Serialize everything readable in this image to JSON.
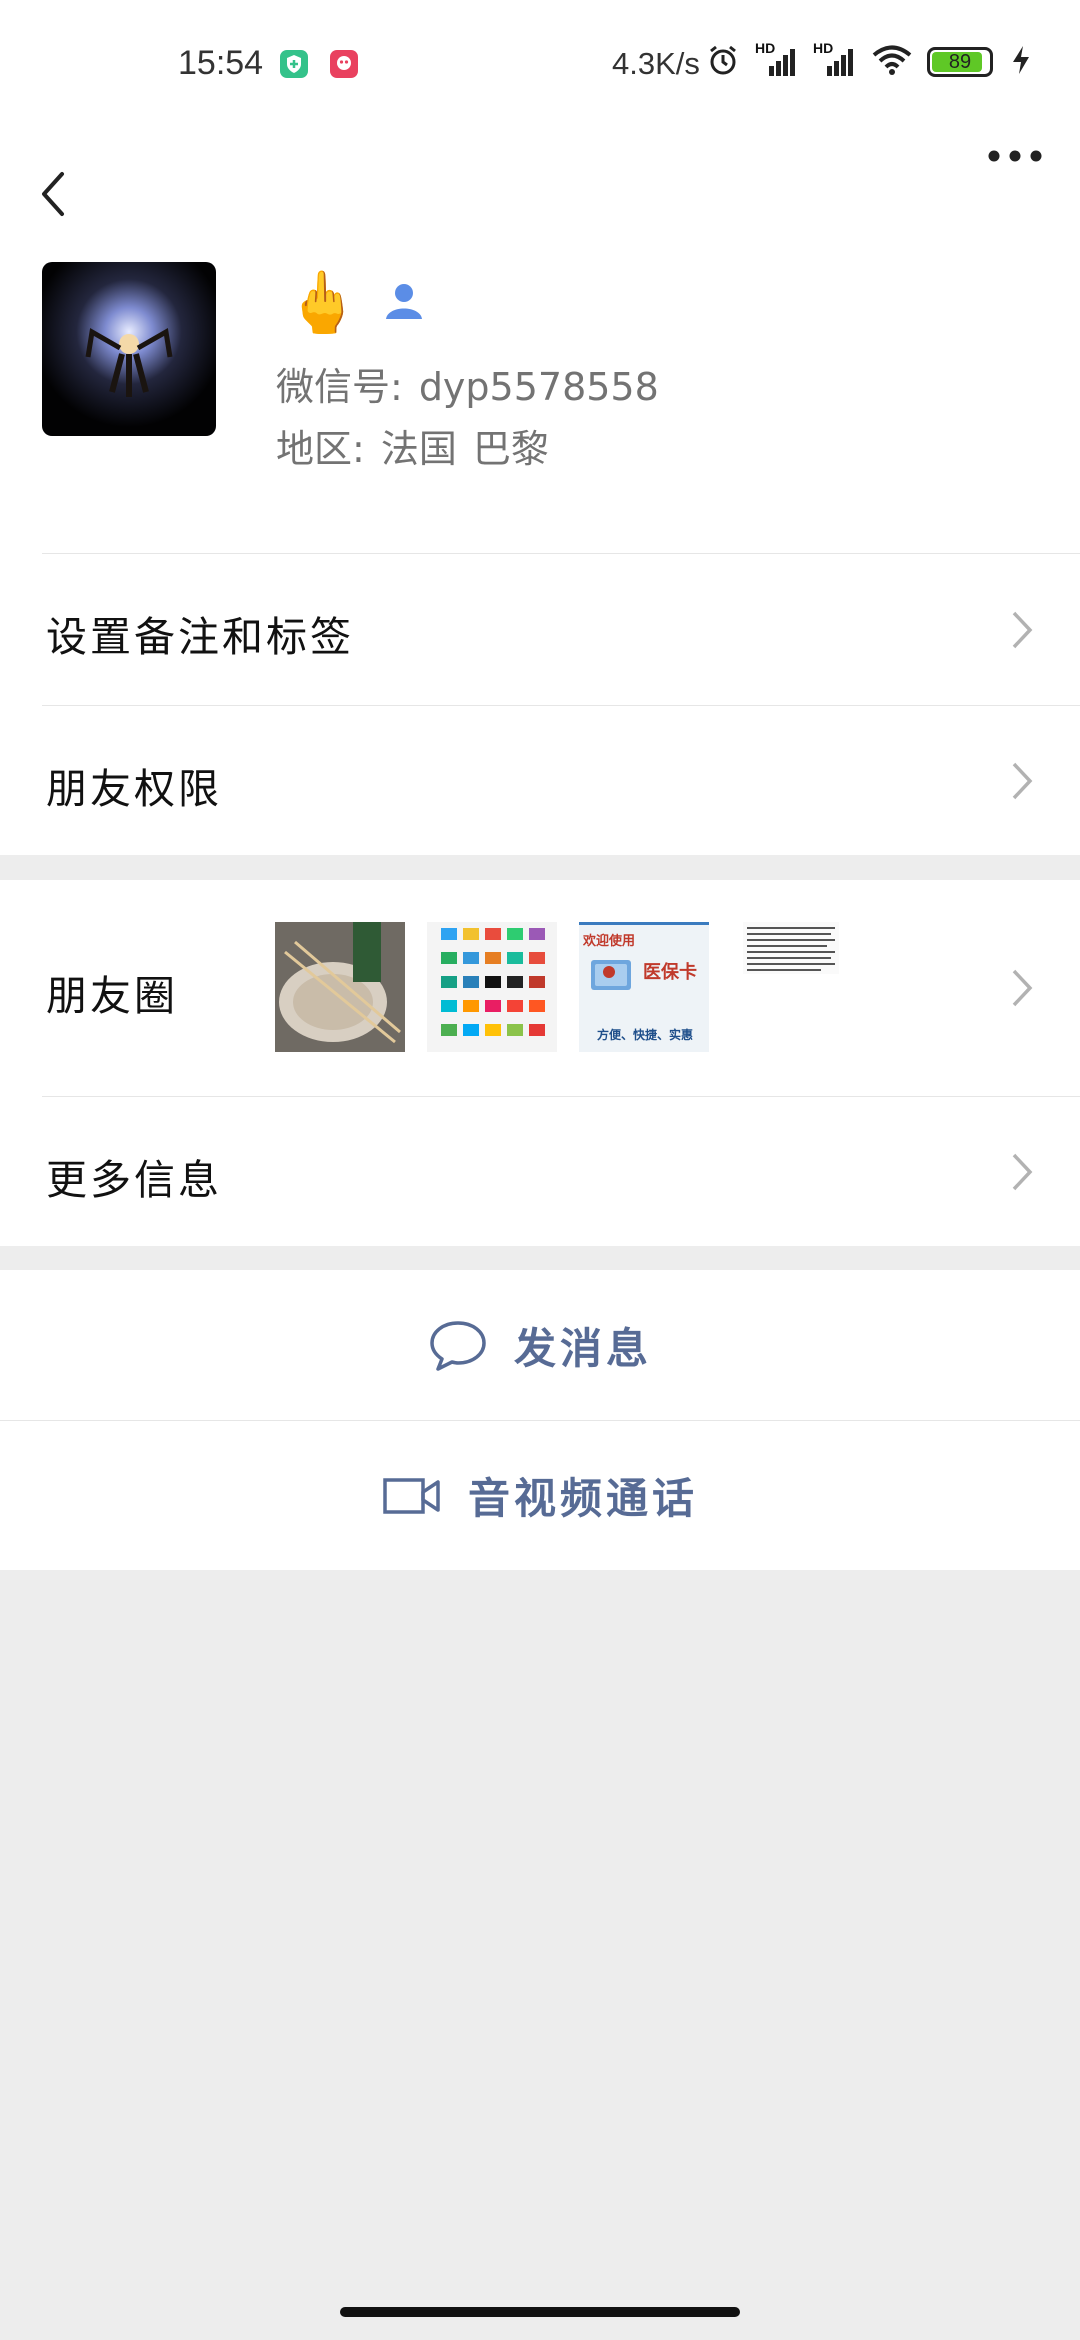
{
  "status_bar": {
    "time": "15:54",
    "network_speed": "4.3K/s",
    "signal1_label": "HD",
    "signal2_label": "HD",
    "battery": "89",
    "battery_level": 0.89,
    "icons": [
      "shield-app-icon",
      "red-app-icon",
      "alarm-icon",
      "signal-icon",
      "signal-icon",
      "wifi-icon",
      "battery-icon",
      "charging-icon"
    ]
  },
  "nav": {
    "back_icon": "chevron-left-icon",
    "more_icon": "more-dots-icon"
  },
  "profile": {
    "nickname": "🖕",
    "wechat_id_label": "微信号:",
    "wechat_id": "dyp5578558",
    "region_label": "地区:",
    "region_country": "法国",
    "region_city": "巴黎"
  },
  "menu": {
    "remark_tags": "设置备注和标签",
    "friend_permissions": "朋友权限",
    "moments": "朋友圈",
    "more_info": "更多信息"
  },
  "moments_thumbs": {
    "thumb3_title": "欢迎使用",
    "thumb3_card": "医保卡",
    "thumb3_footer": "方便、快捷、实惠"
  },
  "actions": {
    "send_message": "发消息",
    "video_call": "音视频通话"
  },
  "colors": {
    "link_blue": "#576b95",
    "background": "#ededed",
    "battery_green": "#5fc826"
  }
}
